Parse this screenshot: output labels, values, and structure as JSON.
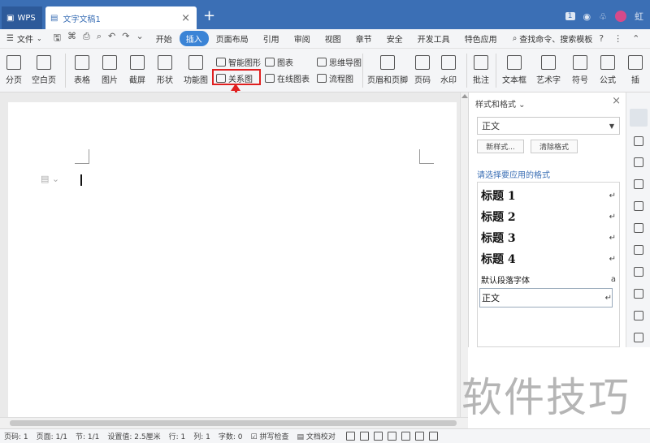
{
  "titlebar": {
    "app_tab": "WPS",
    "doc_tab": "文字文稿1",
    "close": "×",
    "new_tab": "+",
    "page_count_badge": "1",
    "user_name": "虹"
  },
  "menubar": {
    "file": "文件",
    "tabs": [
      "开始",
      "插入",
      "页面布局",
      "引用",
      "审阅",
      "视图",
      "章节",
      "安全",
      "开发工具",
      "特色应用"
    ],
    "active_tab": "插入",
    "search": "查找命令、搜索模板",
    "help": "?"
  },
  "ribbon": {
    "fenye": "分页",
    "kongbaiye": "空白页",
    "biaoge": "表格",
    "tupian": "图片",
    "jieping": "截屏",
    "xingzhuang": "形状",
    "gongnengtu": "功能图",
    "zhineng_tuxing": "智能图形",
    "guanxitu": "关系图",
    "tubiao": "图表",
    "zaixian_tubiao": "在线图表",
    "siweidaotu": "思维导图",
    "liuchengtu": "流程图",
    "yemei_yejiao": "页眉和页脚",
    "yema": "页码",
    "shuiyin": "水印",
    "pizhu": "批注",
    "wenbenkuang": "文本框",
    "yishuzi": "艺术字",
    "fuhao": "符号",
    "gongshi": "公式",
    "cha": "插"
  },
  "panel": {
    "title": "样式和格式",
    "current_style": "正文",
    "new_style": "新样式...",
    "clear_format": "清除格式",
    "prompt": "请选择要应用的格式",
    "styles": [
      {
        "label": "标题 1",
        "mark": "↵"
      },
      {
        "label": "标题 2",
        "mark": "↵"
      },
      {
        "label": "标题 3",
        "mark": "↵"
      },
      {
        "label": "标题 4",
        "mark": "↵"
      },
      {
        "label": "默认段落字体",
        "mark": "a"
      },
      {
        "label": "正文",
        "mark": "↵"
      }
    ]
  },
  "statusbar": {
    "items": [
      "页码: 1",
      "页面: 1/1",
      "节: 1/1",
      "设置值: 2.5厘米",
      "行: 1",
      "列: 1",
      "字数: 0",
      "拼写检查",
      "文档校对"
    ]
  },
  "watermark": "软件技巧",
  "colors": {
    "titlebar": "#3b6fb5",
    "accent": "#3b84d6",
    "highlight": "#e02020"
  }
}
